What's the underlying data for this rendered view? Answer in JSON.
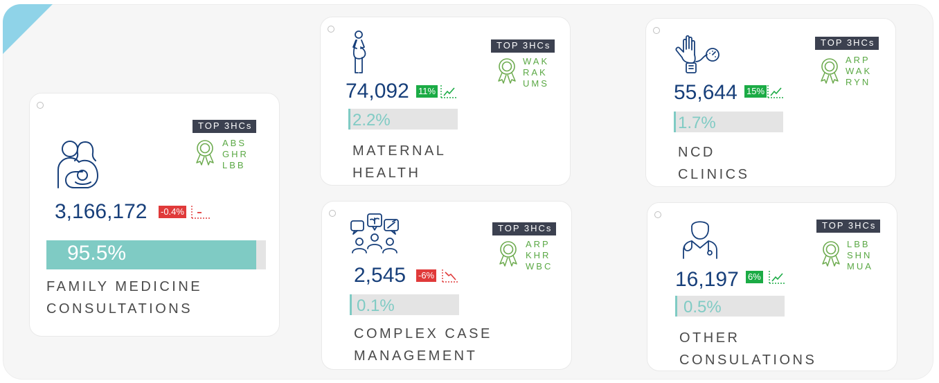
{
  "badge_label": "TOP 3HCs",
  "colors": {
    "up": "#1bab45",
    "down": "#e03a3a",
    "value": "#173f7a",
    "share_fill": "#7fcbc4",
    "share_text": "#80cbc4",
    "hc_codes": "#5aa844"
  },
  "cards": {
    "family": {
      "icon": "family-icon",
      "value": "3,166,172",
      "change": "-0.4%",
      "trend": "flat",
      "share": "95.5%",
      "share_fraction": 0.955,
      "label_line1": "FAMILY MEDICINE",
      "label_line2": "CONSULTATIONS",
      "top_hcs": [
        "ABS",
        "GHR",
        "LBB"
      ]
    },
    "maternal": {
      "icon": "pregnant-woman-icon",
      "value": "74,092",
      "change": "11%",
      "trend": "up",
      "share": "2.2%",
      "share_fraction": 0.022,
      "label_line1": "MATERNAL",
      "label_line2": "HEALTH",
      "top_hcs": [
        "WAK",
        "RAK",
        "UMS"
      ]
    },
    "ncd": {
      "icon": "blood-pressure-icon",
      "value": "55,644",
      "change": "15%",
      "trend": "up",
      "share": "1.7%",
      "share_fraction": 0.017,
      "label_line1": "NCD",
      "label_line2": "CLINICS",
      "top_hcs": [
        "ARP",
        "WAK",
        "RYN"
      ]
    },
    "complex": {
      "icon": "care-team-icon",
      "value": "2,545",
      "change": "-6%",
      "trend": "down",
      "share": "0.1%",
      "share_fraction": 0.001,
      "label_line1": "COMPLEX CASE",
      "label_line2": "MANAGEMENT",
      "top_hcs": [
        "ARP",
        "KHR",
        "WBC"
      ]
    },
    "other": {
      "icon": "doctor-icon",
      "value": "16,197",
      "change": "6%",
      "trend": "up",
      "share": "0.5%",
      "share_fraction": 0.005,
      "label_line1": "OTHER",
      "label_line2": "CONSULATIONS",
      "top_hcs": [
        "LBB",
        "SHN",
        "MUA"
      ]
    }
  }
}
